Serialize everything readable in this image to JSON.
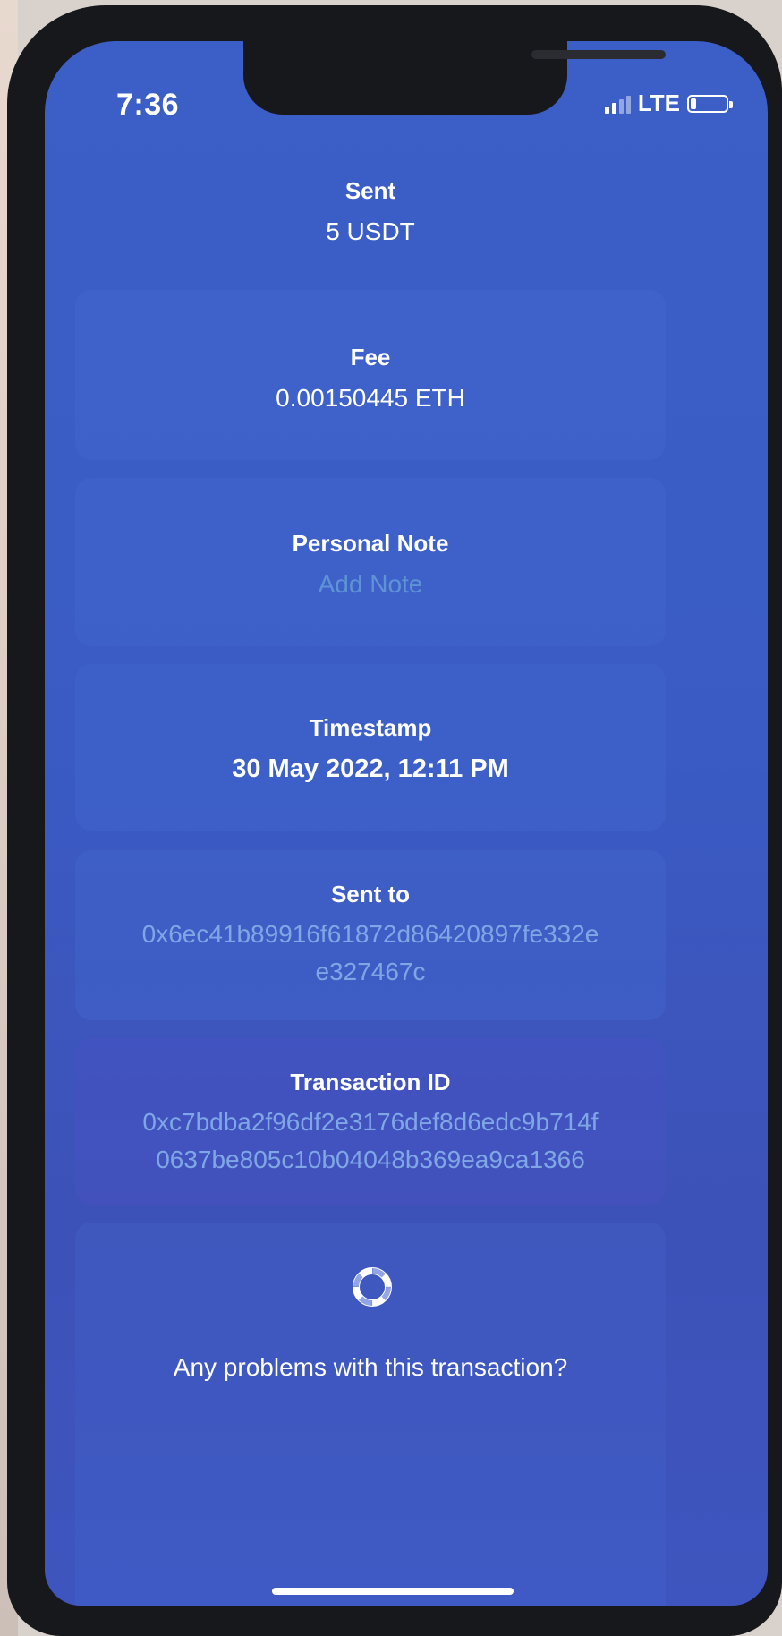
{
  "status_bar": {
    "time": "7:36",
    "network": "LTE",
    "signal_bars": 4,
    "signal_bars_filled": 2
  },
  "transaction": {
    "sent": {
      "label": "Sent",
      "value": "5 USDT"
    },
    "fee": {
      "label": "Fee",
      "value": "0.00150445 ETH"
    },
    "note": {
      "label": "Personal Note",
      "placeholder": "Add Note"
    },
    "timestamp": {
      "label": "Timestamp",
      "value": "30 May 2022, 12:11 PM"
    },
    "sent_to": {
      "label": "Sent to",
      "line1": "0x6ec41b89916f61872d86420897fe332e",
      "line2": "e327467c"
    },
    "transaction_id": {
      "label": "Transaction ID",
      "line1": "0xc7bdba2f96df2e3176def8d6edc9b714f",
      "line2": "0637be805c10b04048b369ea9ca1366"
    }
  },
  "help": {
    "icon": "lifebuoy-icon",
    "link_text": "Any problems with this transaction?"
  },
  "colors": {
    "background": "#3b5fc7",
    "link": "#7fa7e6",
    "placeholder": "#5f93d6"
  }
}
